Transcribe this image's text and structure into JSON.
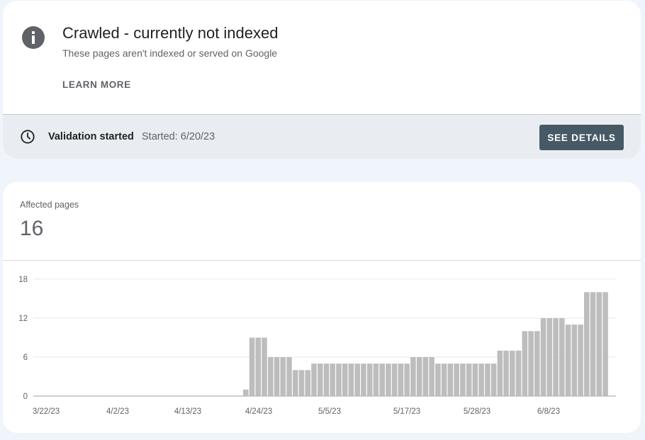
{
  "issue": {
    "title": "Crawled - currently not indexed",
    "description": "These pages aren't indexed or served on Google",
    "learn_more": "LEARN MORE",
    "icon": "info-icon"
  },
  "validation": {
    "status": "Validation started",
    "started": "Started: 6/20/23",
    "button": "SEE DETAILS",
    "icon": "clock-icon"
  },
  "summary": {
    "label": "Affected pages",
    "count": "16"
  },
  "colors": {
    "bar": "#bdbdbd",
    "button": "#455a64",
    "validation_bg": "#e9edf1"
  },
  "chart_data": {
    "type": "bar",
    "ylim": [
      0,
      18
    ],
    "yticks": [
      "0",
      "6",
      "12",
      "18"
    ],
    "xticks": [
      "3/22/23",
      "4/2/23",
      "4/13/23",
      "4/24/23",
      "5/5/23",
      "5/17/23",
      "5/28/23",
      "6/8/23"
    ],
    "grid": true,
    "values": [
      0,
      0,
      0,
      0,
      0,
      0,
      0,
      0,
      0,
      0,
      0,
      0,
      0,
      0,
      0,
      0,
      0,
      0,
      0,
      0,
      0,
      0,
      0,
      0,
      0,
      0,
      0,
      0,
      0,
      0,
      0,
      0,
      1,
      9,
      9,
      9,
      6,
      6,
      6,
      6,
      4,
      4,
      4,
      5,
      5,
      5,
      5,
      5,
      5,
      5,
      5,
      5,
      5,
      5,
      5,
      5,
      5,
      5,
      5,
      6,
      6,
      6,
      6,
      5,
      5,
      5,
      5,
      5,
      5,
      5,
      5,
      5,
      5,
      7,
      7,
      7,
      7,
      10,
      10,
      10,
      12,
      12,
      12,
      12,
      11,
      11,
      11,
      16,
      16,
      16,
      16
    ]
  }
}
